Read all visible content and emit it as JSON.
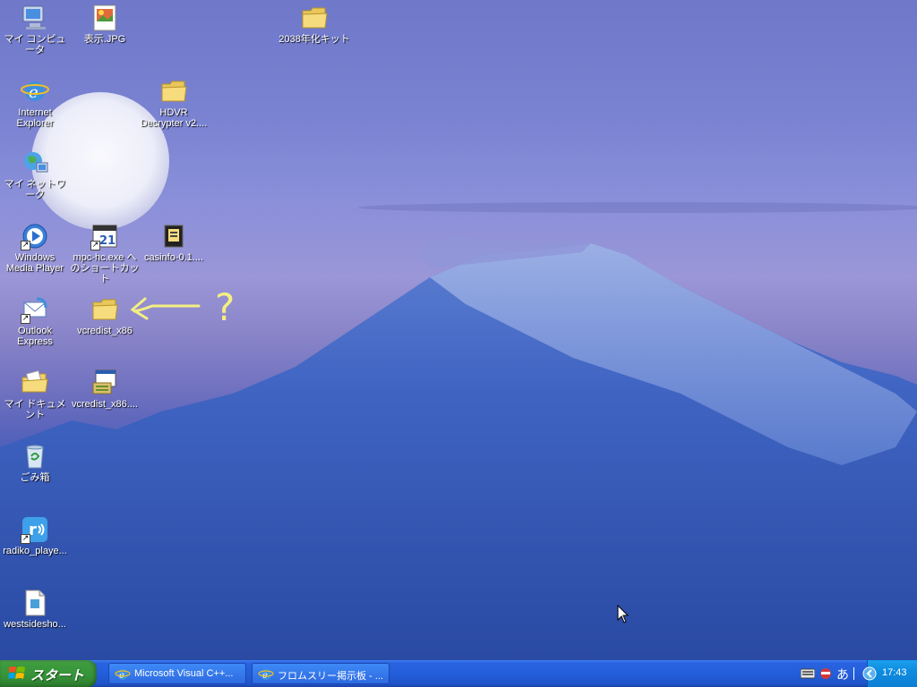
{
  "desktop": {
    "icons": {
      "my_computer": "マイ コンピュータ",
      "hyoji_jpg": "表示.JPG",
      "y2038_kit": "2038年化キット",
      "internet_explorer": "Internet\nExplorer",
      "hdvr_decrypter": "HDVR\nDecrypter v2....",
      "my_network": "マイ ネットワーク",
      "windows_media_player": "Windows\nMedia Player",
      "mpc_hc_shortcut": "mpc-hc.exe へ\nのショートカット",
      "casinfo": "casinfo-0.1....",
      "outlook_express": "Outlook\nExpress",
      "vcredist_folder": "vcredist_x86",
      "my_documents": "マイ ドキュメント",
      "vcredist_exe": "vcredist_x86....",
      "recycle_bin": "ごみ箱",
      "radiko_player": "radiko_playe...",
      "westsidesho": "westsidesho..."
    },
    "annotation": {
      "text": "?"
    }
  },
  "taskbar": {
    "start_label": "スタート",
    "tasks": [
      {
        "label": "Microsoft Visual C++..."
      },
      {
        "label": "フロムスリー掲示板 - ..."
      }
    ],
    "tray": {
      "ime_label": "あ",
      "clock": "17:43"
    }
  }
}
